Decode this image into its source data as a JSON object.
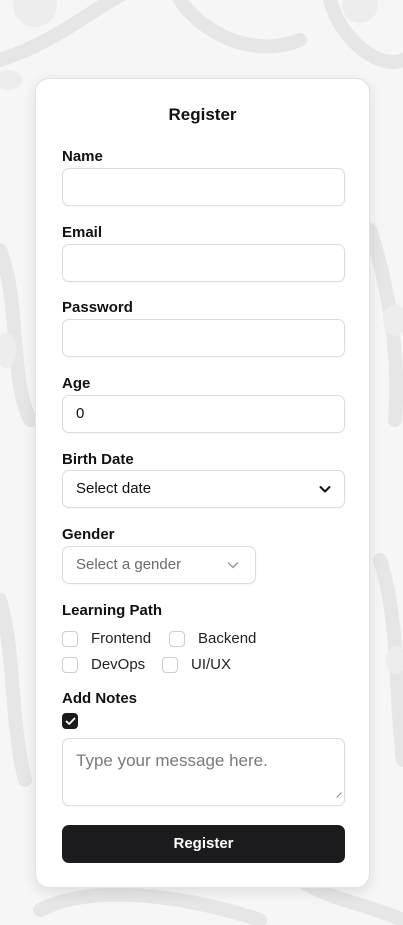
{
  "form": {
    "title": "Register",
    "name": {
      "label": "Name",
      "value": ""
    },
    "email": {
      "label": "Email",
      "value": ""
    },
    "password": {
      "label": "Password",
      "value": ""
    },
    "age": {
      "label": "Age",
      "value": "0"
    },
    "birth_date": {
      "label": "Birth Date",
      "placeholder": "Select date"
    },
    "gender": {
      "label": "Gender",
      "placeholder": "Select a gender"
    },
    "learning_path": {
      "label": "Learning Path",
      "options": [
        {
          "label": "Frontend",
          "checked": false
        },
        {
          "label": "Backend",
          "checked": false
        },
        {
          "label": "DevOps",
          "checked": false
        },
        {
          "label": "UI/UX",
          "checked": false
        }
      ]
    },
    "notes": {
      "label": "Add Notes",
      "checked": true,
      "placeholder": "Type your message here."
    },
    "submit_label": "Register"
  },
  "icons": {
    "birth_date_chevron": "chevron-down-icon",
    "gender_chevron": "chevron-down-icon",
    "check": "check-icon",
    "resize": "resize-handle-icon"
  },
  "colors": {
    "primary": "#1b1b1d",
    "border": "#dcdcdc",
    "background": "#f6f6f6"
  }
}
